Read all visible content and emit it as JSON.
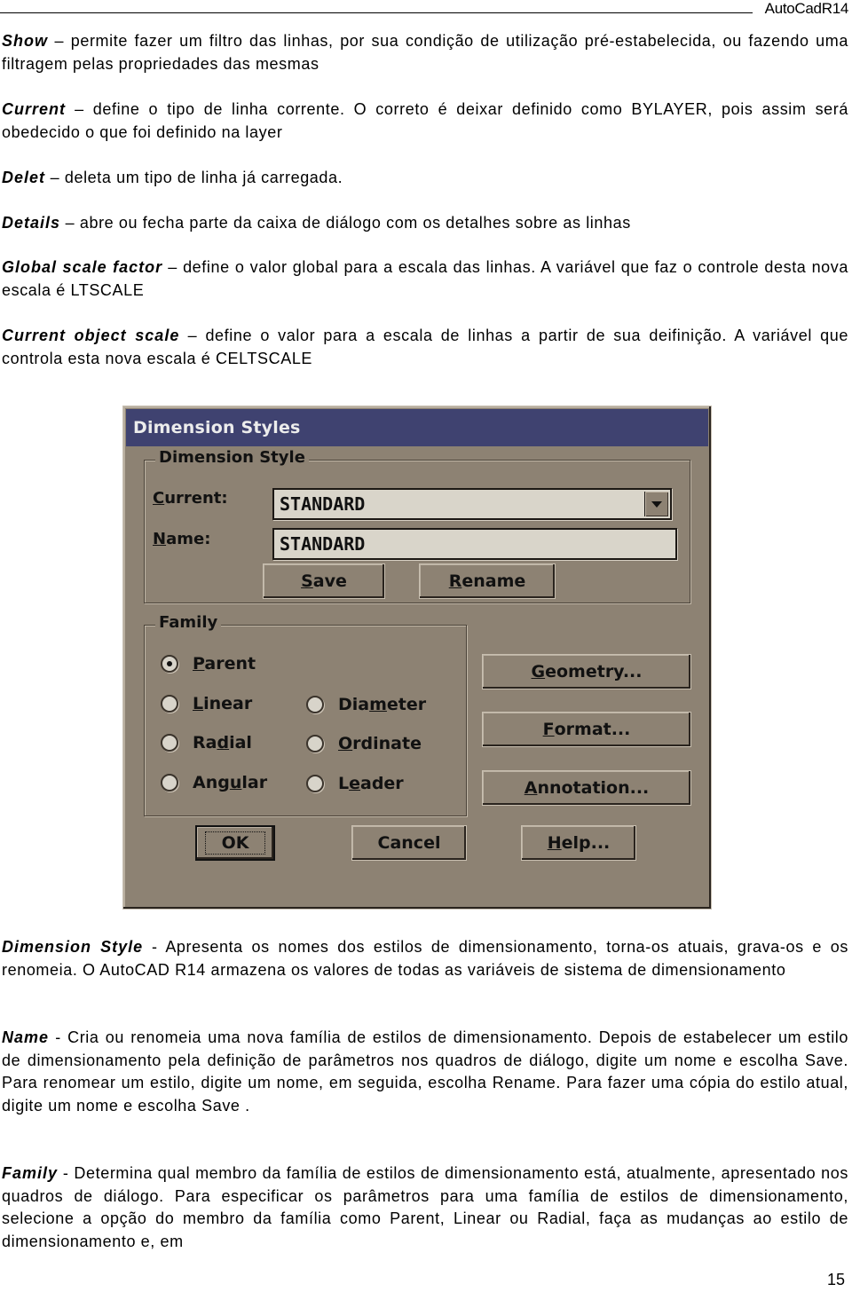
{
  "header": {
    "title": "AutoCadR14"
  },
  "paragraphs_top": [
    {
      "term": "Show",
      "sep": " – ",
      "text": "permite fazer um filtro das linhas, por sua condição de utilização pré-estabelecida, ou fazendo uma filtragem pelas propriedades das mesmas"
    },
    {
      "term": "Current",
      "sep": " – ",
      "text": "define o tipo de linha corrente. O correto é deixar definido como BYLAYER, pois assim será obedecido o que foi definido na layer"
    },
    {
      "term": "Delet",
      "sep": " – ",
      "text": "deleta um tipo de linha já carregada."
    },
    {
      "term": "Details",
      "sep": " – ",
      "text": "abre ou fecha parte da caixa de diálogo com os detalhes sobre as linhas"
    },
    {
      "term": "Global scale factor",
      "sep": " – ",
      "text": "define o valor global para a escala das linhas. A variável que faz o controle desta nova escala é LTSCALE"
    },
    {
      "term": "Current object scale",
      "sep": " – ",
      "text": "define o valor para a escala de linhas a partir de sua deifinição. A variável que controla esta nova escala é CELTSCALE"
    }
  ],
  "dialog": {
    "title": "Dimension Styles",
    "dimension_style_group": {
      "label": "Dimension Style",
      "current_label_key": "C",
      "current_label_rest": "urrent:",
      "current_value": "STANDARD",
      "name_label_key": "N",
      "name_label_rest": "ame:",
      "name_value": "STANDARD",
      "save_key": "S",
      "save_rest": "ave",
      "rename_key": "R",
      "rename_rest": "ename"
    },
    "family_group": {
      "label": "Family",
      "options": [
        {
          "pre": "",
          "key": "P",
          "post": "arent",
          "checked": true
        },
        {
          "pre": "",
          "key": "L",
          "post": "inear",
          "checked": false
        },
        {
          "pre": "Dia",
          "key": "m",
          "post": "eter",
          "checked": false
        },
        {
          "pre": "Ra",
          "key": "d",
          "post": "ial",
          "checked": false
        },
        {
          "pre": "",
          "key": "O",
          "post": "rdinate",
          "checked": false
        },
        {
          "pre": "Ang",
          "key": "u",
          "post": "lar",
          "checked": false
        },
        {
          "pre": "L",
          "key": "e",
          "post": "ader",
          "checked": false
        }
      ]
    },
    "side_buttons": [
      {
        "key": "G",
        "rest": "eometry..."
      },
      {
        "key": "F",
        "rest": "ormat..."
      },
      {
        "key": "A",
        "rest": "nnotation..."
      }
    ],
    "bottom_buttons": {
      "ok": "OK",
      "cancel": "Cancel",
      "help_key": "H",
      "help_rest": "elp..."
    }
  },
  "paragraphs_bottom": [
    {
      "term": "Dimension Style",
      "sep": " - ",
      "text": "Apresenta os nomes dos estilos de dimensionamento, torna-os atuais, grava-os e os renomeia. O AutoCAD R14 armazena os valores de todas as variáveis de sistema de dimensionamento"
    },
    {
      "term": "Name",
      "sep": " - ",
      "text": "Cria ou renomeia uma nova família de estilos de dimensionamento. Depois de estabelecer um estilo de dimensionamento pela definição de parâmetros nos quadros de diálogo, digite um nome e escolha Save. Para renomear um estilo, digite um nome, em seguida, escolha Rename. Para fazer uma cópia do estilo atual, digite um nome e escolha Save ."
    },
    {
      "term": "Family",
      "sep": " - ",
      "text": "Determina qual membro da família de estilos de dimensionamento está, atualmente, apresentado nos quadros de diálogo. Para especificar os parâmetros para uma família de estilos de dimensionamento, selecione a opção do membro da família como Parent, Linear ou Radial, faça as mudanças ao estilo de dimensionamento e, em"
    }
  ],
  "footer": {
    "page_number": "15"
  }
}
